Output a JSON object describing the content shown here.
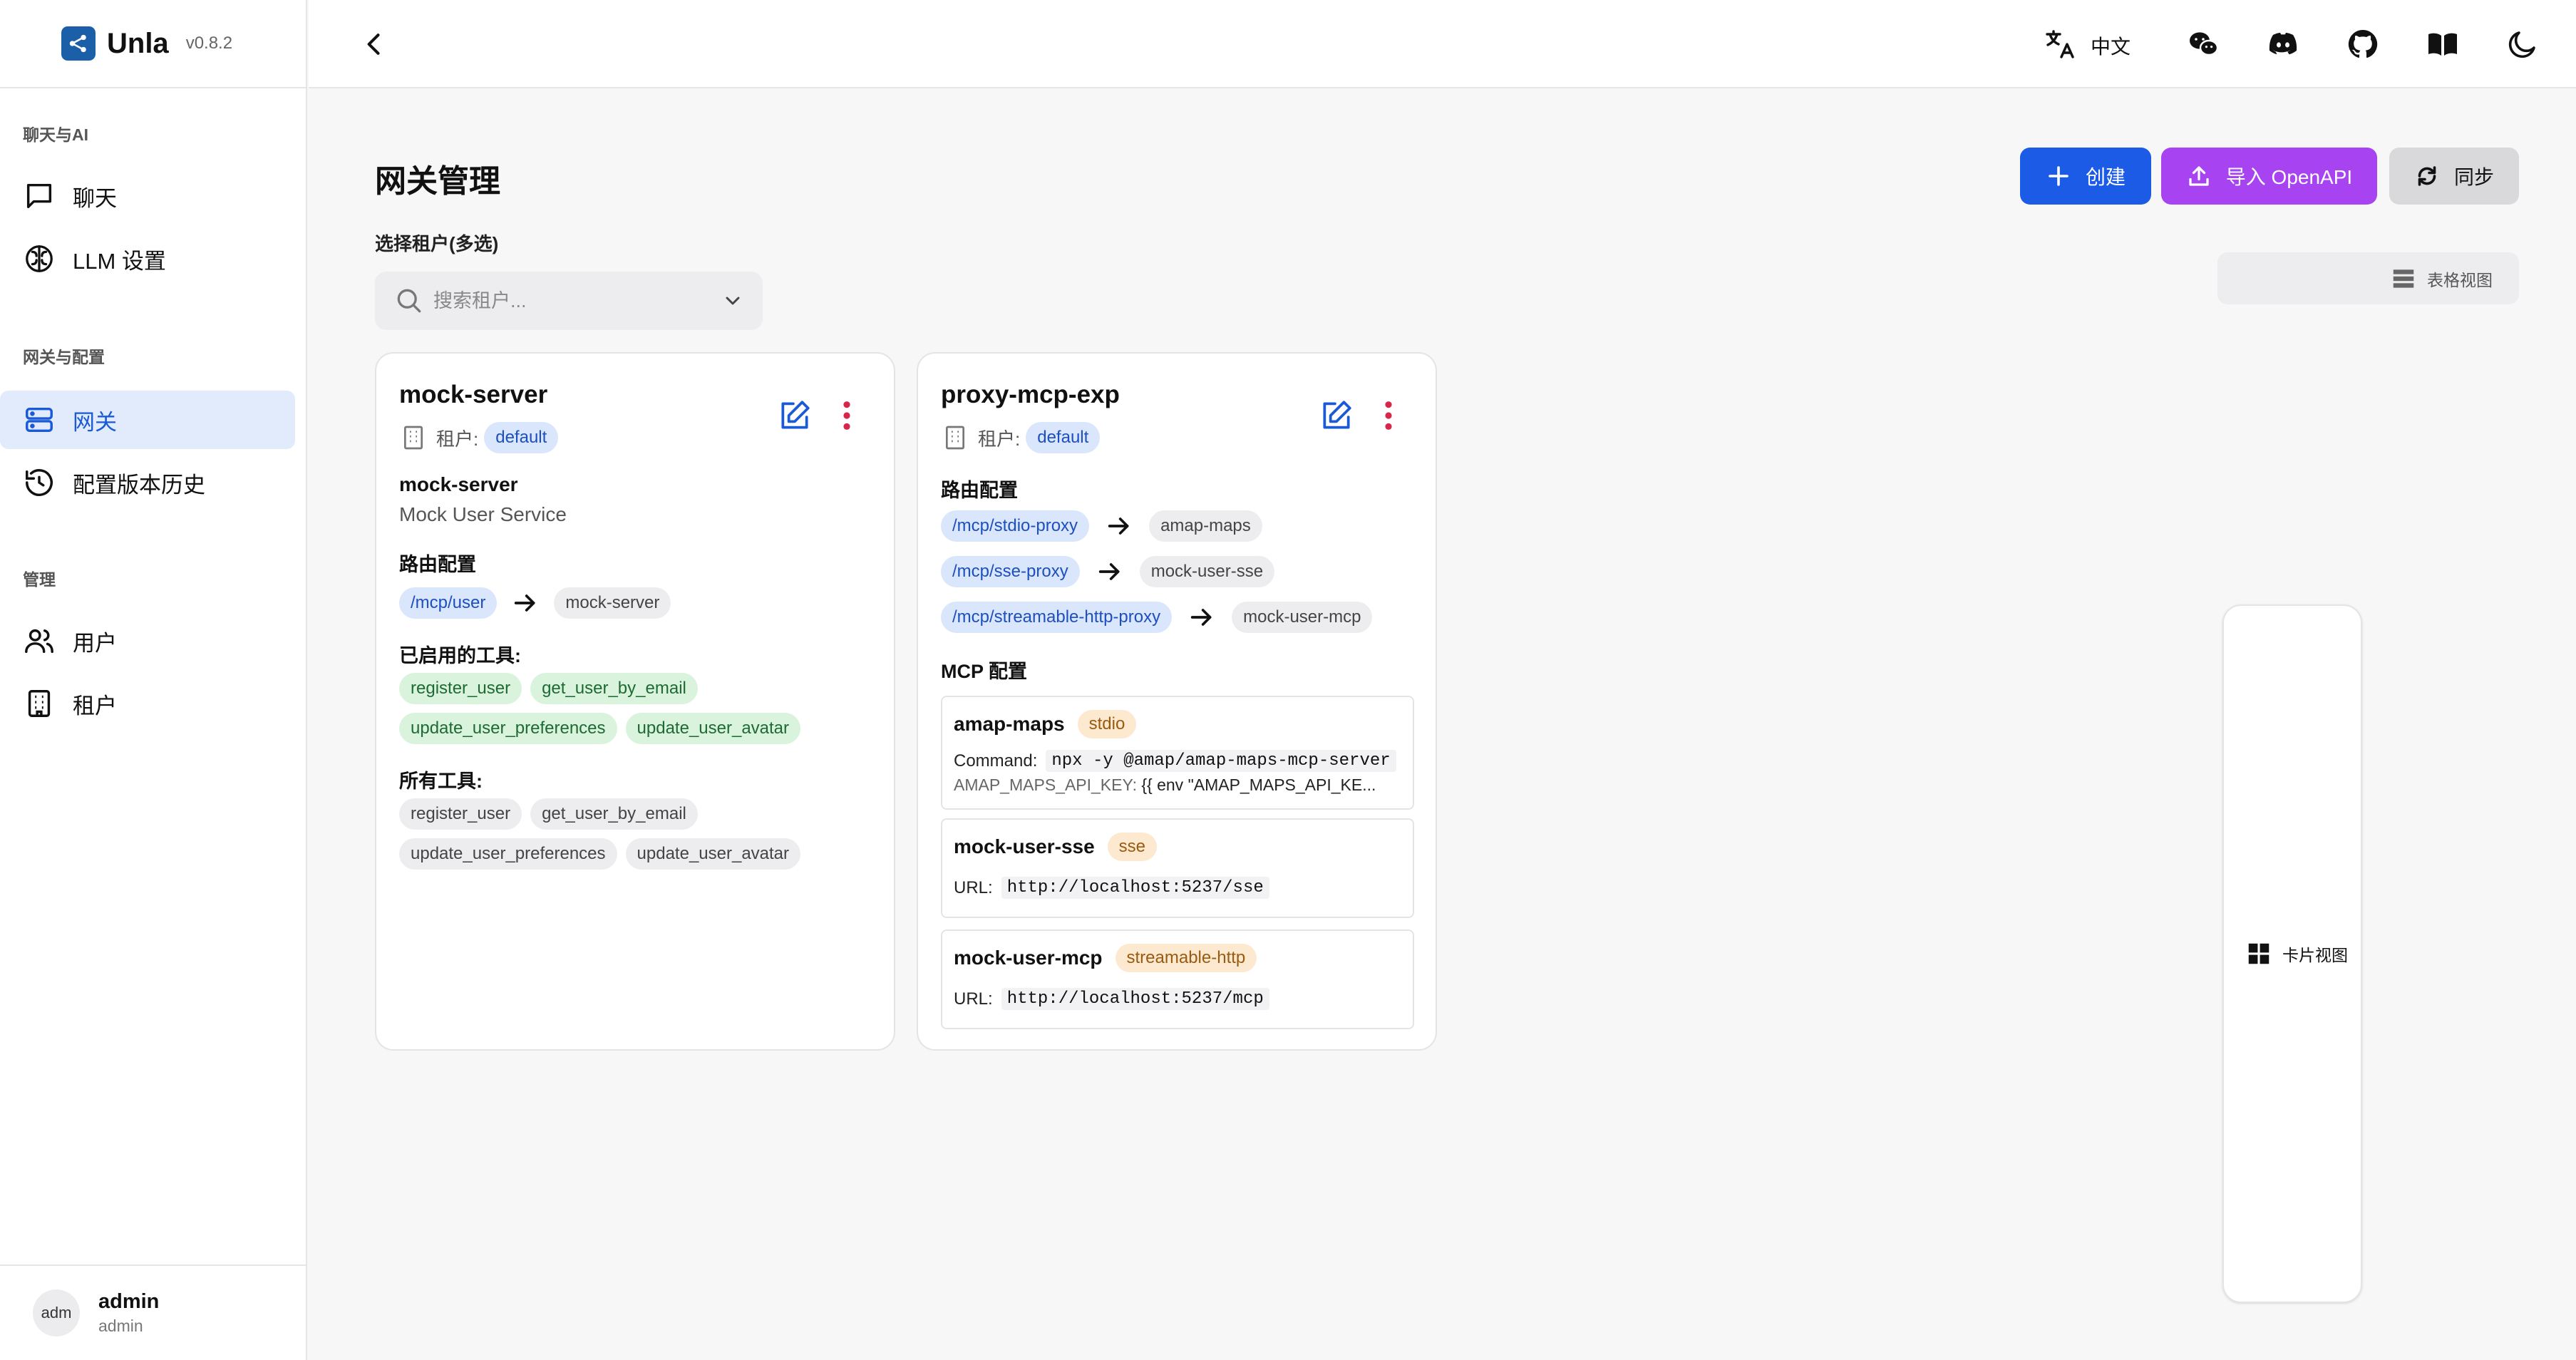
{
  "app": {
    "name": "Unla",
    "version": "v0.8.2"
  },
  "sidebar": {
    "sections": [
      {
        "title": "聊天与AI",
        "items": [
          {
            "label": "聊天"
          },
          {
            "label": "LLM 设置"
          }
        ]
      },
      {
        "title": "网关与配置",
        "items": [
          {
            "label": "网关",
            "active": true
          },
          {
            "label": "配置版本历史"
          }
        ]
      },
      {
        "title": "管理",
        "items": [
          {
            "label": "用户"
          },
          {
            "label": "租户"
          }
        ]
      }
    ],
    "user": {
      "avatar": "adm",
      "name": "admin",
      "role": "admin"
    }
  },
  "topbar": {
    "language": "中文"
  },
  "page": {
    "title": "网关管理",
    "buttons": {
      "create": "创建",
      "import": "导入 OpenAPI",
      "sync": "同步"
    },
    "tenant_filter": {
      "label": "选择租户(多选)",
      "placeholder": "搜索租户..."
    },
    "views": {
      "card": "卡片视图",
      "table": "表格视图"
    }
  },
  "labels": {
    "tenant": "租户:",
    "routes": "路由配置",
    "enabled_tools": "已启用的工具:",
    "all_tools": "所有工具:",
    "mcp_config": "MCP 配置",
    "command": "Command:",
    "url": "URL:"
  },
  "cards": [
    {
      "title": "mock-server",
      "tenant": "default",
      "server_name": "mock-server",
      "server_desc": "Mock User Service",
      "routes": [
        {
          "path": "/mcp/user",
          "target": "mock-server"
        }
      ],
      "enabled_tools": [
        "register_user",
        "get_user_by_email",
        "update_user_preferences",
        "update_user_avatar"
      ],
      "all_tools": [
        "register_user",
        "get_user_by_email",
        "update_user_preferences",
        "update_user_avatar"
      ]
    },
    {
      "title": "proxy-mcp-exp",
      "tenant": "default",
      "routes": [
        {
          "path": "/mcp/stdio-proxy",
          "target": "amap-maps"
        },
        {
          "path": "/mcp/sse-proxy",
          "target": "mock-user-sse"
        },
        {
          "path": "/mcp/streamable-http-proxy",
          "target": "mock-user-mcp"
        }
      ],
      "mcp_servers": [
        {
          "name": "amap-maps",
          "type": "stdio",
          "command": "npx -y @amap/amap-maps-mcp-server",
          "env_key": "AMAP_MAPS_API_KEY:",
          "env_value": "{{ env \"AMAP_MAPS_API_KE..."
        },
        {
          "name": "mock-user-sse",
          "type": "sse",
          "url": "http://localhost:5237/sse"
        },
        {
          "name": "mock-user-mcp",
          "type": "streamable-http",
          "url": "http://localhost:5237/mcp"
        }
      ]
    }
  ]
}
